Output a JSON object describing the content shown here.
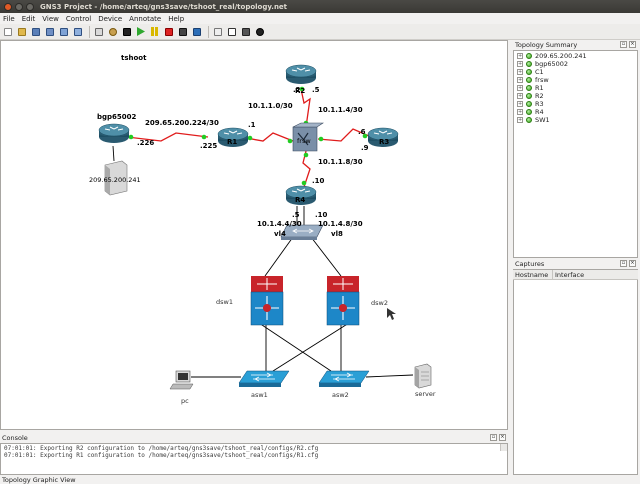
{
  "window": {
    "title": "GNS3 Project - /home/arteq/gns3save/tshoot_real/topology.net"
  },
  "menu": [
    "File",
    "Edit",
    "View",
    "Control",
    "Device",
    "Annotate",
    "Help"
  ],
  "toolbar": {
    "icons": [
      "new-icon",
      "open-icon",
      "save-icon",
      "save-as-icon",
      "import-icon",
      "export-icon",
      "add-link-icon",
      "capture-icon",
      "terminal-icon",
      "start-icon",
      "pause-icon",
      "stop-icon",
      "reload-icon",
      "virtualbox-icon",
      "screenshot-icon",
      "note-icon",
      "rectangle-icon",
      "ellipse-icon"
    ]
  },
  "canvas": {
    "title": "tshoot",
    "devices": {
      "r2": "R2",
      "r1": "R1",
      "r3": "R3",
      "r4": "R4",
      "frsw": "frsw",
      "bgp": "bgp65002",
      "c1": "209.65.200.241",
      "sw1": "vl4",
      "dsw1": "dsw1",
      "dsw2": "dsw2",
      "asw1": "asw1",
      "asw2": "asw2",
      "pc": "pc",
      "server": "server"
    },
    "labels": {
      "net_r1_bgp": "209.65.200.224/30",
      "bgp_if": ".226",
      "r1_if_bgp": ".225",
      "r1_if_frsw": ".1",
      "net_r2": "10.1.1.0/30",
      "net_r2b": "10.1.1.4/30",
      "r2_if_a": ".2",
      "r2_if_b": ".5",
      "r3_if_a": ".6",
      "r3_if_b": ".9",
      "net_r4": "10.1.1.8/30",
      "r4_if": ".10",
      "r4_vl4": ".5",
      "r4_vl8": ".10",
      "net_vl4": "10.1.4.4/30",
      "net_vl8": "10.1.4.8/30",
      "vl8": "vl8"
    }
  },
  "topology_summary": {
    "title": "Topology Summary",
    "items": [
      "209.65.200.241",
      "bgp65002",
      "C1",
      "frsw",
      "R1",
      "R2",
      "R3",
      "R4",
      "SW1"
    ]
  },
  "captures": {
    "title": "Captures",
    "columns": [
      "Hostname",
      "Interface"
    ]
  },
  "console": {
    "title": "Console",
    "lines": [
      "07:01:01: Exporting R2 configuration to /home/arteq/gns3save/tshoot_real/configs/R2.cfg",
      "07:01:01: Exporting R1 configuration to /home/arteq/gns3save/tshoot_real/configs/R1.cfg"
    ]
  },
  "status": {
    "text": "Topology Graphic View"
  }
}
